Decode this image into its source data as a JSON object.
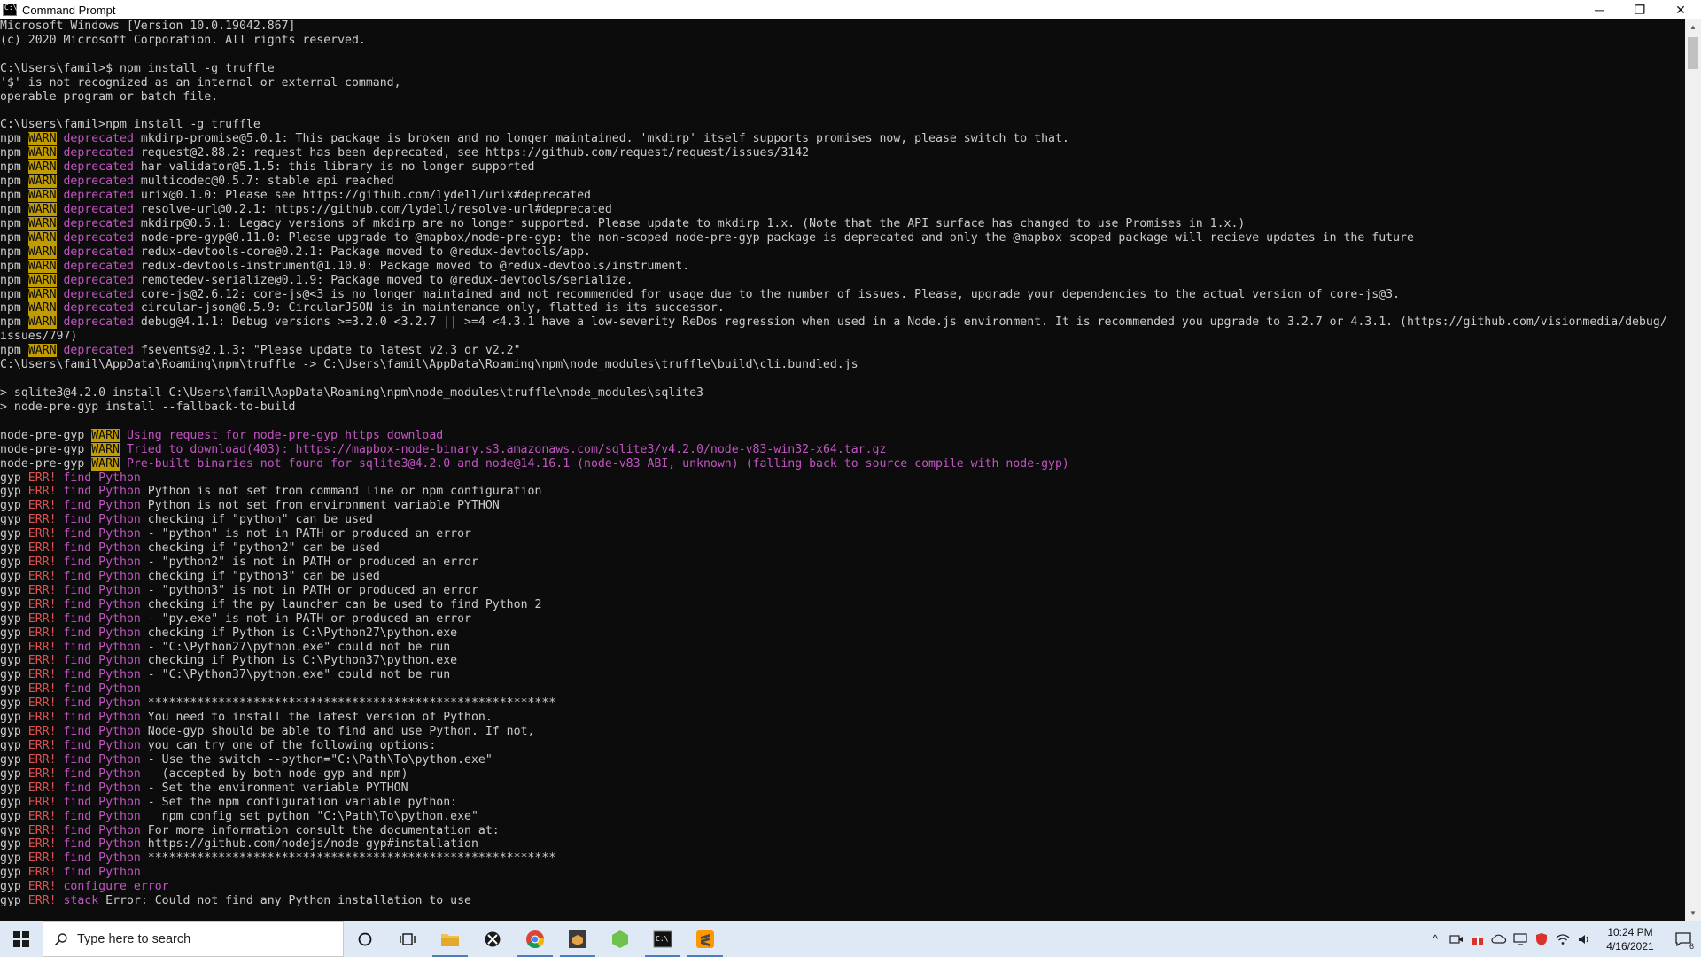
{
  "window": {
    "title": "Command Prompt",
    "controls": {
      "minimize": "─",
      "maximize": "❐",
      "close": "✕"
    }
  },
  "console": {
    "lines": [
      [
        {
          "t": "Microsoft Windows [Version 10.0.19042.867]"
        }
      ],
      [
        {
          "t": "(c) 2020 Microsoft Corporation. All rights reserved."
        }
      ],
      [
        {
          "t": ""
        }
      ],
      [
        {
          "t": "C:\\Users\\famil>$ npm install -g truffle"
        }
      ],
      [
        {
          "t": "'$' is not recognized as an internal or external command,"
        }
      ],
      [
        {
          "t": "operable program or batch file."
        }
      ],
      [
        {
          "t": ""
        }
      ],
      [
        {
          "t": "C:\\Users\\famil>npm install -g truffle"
        }
      ],
      [
        {
          "t": "npm "
        },
        {
          "t": "WARN",
          "s": "warn"
        },
        {
          "t": " "
        },
        {
          "t": "deprecated",
          "s": "mag"
        },
        {
          "t": " mkdirp-promise@5.0.1: This package is broken and no longer maintained. 'mkdirp' itself supports promises now, please switch to that."
        }
      ],
      [
        {
          "t": "npm "
        },
        {
          "t": "WARN",
          "s": "warn"
        },
        {
          "t": " "
        },
        {
          "t": "deprecated",
          "s": "mag"
        },
        {
          "t": " request@2.88.2: request has been deprecated, see https://github.com/request/request/issues/3142"
        }
      ],
      [
        {
          "t": "npm "
        },
        {
          "t": "WARN",
          "s": "warn"
        },
        {
          "t": " "
        },
        {
          "t": "deprecated",
          "s": "mag"
        },
        {
          "t": " har-validator@5.1.5: this library is no longer supported"
        }
      ],
      [
        {
          "t": "npm "
        },
        {
          "t": "WARN",
          "s": "warn"
        },
        {
          "t": " "
        },
        {
          "t": "deprecated",
          "s": "mag"
        },
        {
          "t": " multicodec@0.5.7: stable api reached"
        }
      ],
      [
        {
          "t": "npm "
        },
        {
          "t": "WARN",
          "s": "warn"
        },
        {
          "t": " "
        },
        {
          "t": "deprecated",
          "s": "mag"
        },
        {
          "t": " urix@0.1.0: Please see https://github.com/lydell/urix#deprecated"
        }
      ],
      [
        {
          "t": "npm "
        },
        {
          "t": "WARN",
          "s": "warn"
        },
        {
          "t": " "
        },
        {
          "t": "deprecated",
          "s": "mag"
        },
        {
          "t": " resolve-url@0.2.1: https://github.com/lydell/resolve-url#deprecated"
        }
      ],
      [
        {
          "t": "npm "
        },
        {
          "t": "WARN",
          "s": "warn"
        },
        {
          "t": " "
        },
        {
          "t": "deprecated",
          "s": "mag"
        },
        {
          "t": " mkdirp@0.5.1: Legacy versions of mkdirp are no longer supported. Please update to mkdirp 1.x. (Note that the API surface has changed to use Promises in 1.x.)"
        }
      ],
      [
        {
          "t": "npm "
        },
        {
          "t": "WARN",
          "s": "warn"
        },
        {
          "t": " "
        },
        {
          "t": "deprecated",
          "s": "mag"
        },
        {
          "t": " node-pre-gyp@0.11.0: Please upgrade to @mapbox/node-pre-gyp: the non-scoped node-pre-gyp package is deprecated and only the @mapbox scoped package will recieve updates in the future"
        }
      ],
      [
        {
          "t": "npm "
        },
        {
          "t": "WARN",
          "s": "warn"
        },
        {
          "t": " "
        },
        {
          "t": "deprecated",
          "s": "mag"
        },
        {
          "t": " redux-devtools-core@0.2.1: Package moved to @redux-devtools/app."
        }
      ],
      [
        {
          "t": "npm "
        },
        {
          "t": "WARN",
          "s": "warn"
        },
        {
          "t": " "
        },
        {
          "t": "deprecated",
          "s": "mag"
        },
        {
          "t": " redux-devtools-instrument@1.10.0: Package moved to @redux-devtools/instrument."
        }
      ],
      [
        {
          "t": "npm "
        },
        {
          "t": "WARN",
          "s": "warn"
        },
        {
          "t": " "
        },
        {
          "t": "deprecated",
          "s": "mag"
        },
        {
          "t": " remotedev-serialize@0.1.9: Package moved to @redux-devtools/serialize."
        }
      ],
      [
        {
          "t": "npm "
        },
        {
          "t": "WARN",
          "s": "warn"
        },
        {
          "t": " "
        },
        {
          "t": "deprecated",
          "s": "mag"
        },
        {
          "t": " core-js@2.6.12: core-js@<3 is no longer maintained and not recommended for usage due to the number of issues. Please, upgrade your dependencies to the actual version of core-js@3."
        }
      ],
      [
        {
          "t": "npm "
        },
        {
          "t": "WARN",
          "s": "warn"
        },
        {
          "t": " "
        },
        {
          "t": "deprecated",
          "s": "mag"
        },
        {
          "t": " circular-json@0.5.9: CircularJSON is in maintenance only, flatted is its successor."
        }
      ],
      [
        {
          "t": "npm "
        },
        {
          "t": "WARN",
          "s": "warn"
        },
        {
          "t": " "
        },
        {
          "t": "deprecated",
          "s": "mag"
        },
        {
          "t": " debug@4.1.1: Debug versions >=3.2.0 <3.2.7 || >=4 <4.3.1 have a low-severity ReDos regression when used in a Node.js environment. It is recommended you upgrade to 3.2.7 or 4.3.1. (https://github.com/visionmedia/debug/"
        }
      ],
      [
        {
          "t": "issues/797)"
        }
      ],
      [
        {
          "t": "npm "
        },
        {
          "t": "WARN",
          "s": "warn"
        },
        {
          "t": " "
        },
        {
          "t": "deprecated",
          "s": "mag"
        },
        {
          "t": " fsevents@2.1.3: \"Please update to latest v2.3 or v2.2\""
        }
      ],
      [
        {
          "t": "C:\\Users\\famil\\AppData\\Roaming\\npm\\truffle -> C:\\Users\\famil\\AppData\\Roaming\\npm\\node_modules\\truffle\\build\\cli.bundled.js"
        }
      ],
      [
        {
          "t": ""
        }
      ],
      [
        {
          "t": "> sqlite3@4.2.0 install C:\\Users\\famil\\AppData\\Roaming\\npm\\node_modules\\truffle\\node_modules\\sqlite3"
        }
      ],
      [
        {
          "t": "> node-pre-gyp install --fallback-to-build"
        }
      ],
      [
        {
          "t": ""
        }
      ],
      [
        {
          "t": "node-pre-gyp "
        },
        {
          "t": "WARN",
          "s": "warn"
        },
        {
          "t": " "
        },
        {
          "t": "Using request for node-pre-gyp https download",
          "s": "mag"
        }
      ],
      [
        {
          "t": "node-pre-gyp "
        },
        {
          "t": "WARN",
          "s": "warn"
        },
        {
          "t": " "
        },
        {
          "t": "Tried to download(403): https://mapbox-node-binary.s3.amazonaws.com/sqlite3/v4.2.0/node-v83-win32-x64.tar.gz",
          "s": "mag"
        }
      ],
      [
        {
          "t": "node-pre-gyp "
        },
        {
          "t": "WARN",
          "s": "warn"
        },
        {
          "t": " "
        },
        {
          "t": "Pre-built binaries not found for sqlite3@4.2.0 and node@14.16.1 (node-v83 ABI, unknown) (falling back to source compile with node-gyp)",
          "s": "mag"
        }
      ],
      [
        {
          "t": "gyp "
        },
        {
          "t": "ERR!",
          "s": "err"
        },
        {
          "t": " "
        },
        {
          "t": "find Python",
          "s": "findp"
        }
      ],
      [
        {
          "t": "gyp "
        },
        {
          "t": "ERR!",
          "s": "err"
        },
        {
          "t": " "
        },
        {
          "t": "find Python",
          "s": "findp"
        },
        {
          "t": " Python is not set from command line or npm configuration"
        }
      ],
      [
        {
          "t": "gyp "
        },
        {
          "t": "ERR!",
          "s": "err"
        },
        {
          "t": " "
        },
        {
          "t": "find Python",
          "s": "findp"
        },
        {
          "t": " Python is not set from environment variable PYTHON"
        }
      ],
      [
        {
          "t": "gyp "
        },
        {
          "t": "ERR!",
          "s": "err"
        },
        {
          "t": " "
        },
        {
          "t": "find Python",
          "s": "findp"
        },
        {
          "t": " checking if \"python\" can be used"
        }
      ],
      [
        {
          "t": "gyp "
        },
        {
          "t": "ERR!",
          "s": "err"
        },
        {
          "t": " "
        },
        {
          "t": "find Python",
          "s": "findp"
        },
        {
          "t": " - \"python\" is not in PATH or produced an error"
        }
      ],
      [
        {
          "t": "gyp "
        },
        {
          "t": "ERR!",
          "s": "err"
        },
        {
          "t": " "
        },
        {
          "t": "find Python",
          "s": "findp"
        },
        {
          "t": " checking if \"python2\" can be used"
        }
      ],
      [
        {
          "t": "gyp "
        },
        {
          "t": "ERR!",
          "s": "err"
        },
        {
          "t": " "
        },
        {
          "t": "find Python",
          "s": "findp"
        },
        {
          "t": " - \"python2\" is not in PATH or produced an error"
        }
      ],
      [
        {
          "t": "gyp "
        },
        {
          "t": "ERR!",
          "s": "err"
        },
        {
          "t": " "
        },
        {
          "t": "find Python",
          "s": "findp"
        },
        {
          "t": " checking if \"python3\" can be used"
        }
      ],
      [
        {
          "t": "gyp "
        },
        {
          "t": "ERR!",
          "s": "err"
        },
        {
          "t": " "
        },
        {
          "t": "find Python",
          "s": "findp"
        },
        {
          "t": " - \"python3\" is not in PATH or produced an error"
        }
      ],
      [
        {
          "t": "gyp "
        },
        {
          "t": "ERR!",
          "s": "err"
        },
        {
          "t": " "
        },
        {
          "t": "find Python",
          "s": "findp"
        },
        {
          "t": " checking if the py launcher can be used to find Python 2"
        }
      ],
      [
        {
          "t": "gyp "
        },
        {
          "t": "ERR!",
          "s": "err"
        },
        {
          "t": " "
        },
        {
          "t": "find Python",
          "s": "findp"
        },
        {
          "t": " - \"py.exe\" is not in PATH or produced an error"
        }
      ],
      [
        {
          "t": "gyp "
        },
        {
          "t": "ERR!",
          "s": "err"
        },
        {
          "t": " "
        },
        {
          "t": "find Python",
          "s": "findp"
        },
        {
          "t": " checking if Python is C:\\Python27\\python.exe"
        }
      ],
      [
        {
          "t": "gyp "
        },
        {
          "t": "ERR!",
          "s": "err"
        },
        {
          "t": " "
        },
        {
          "t": "find Python",
          "s": "findp"
        },
        {
          "t": " - \"C:\\Python27\\python.exe\" could not be run"
        }
      ],
      [
        {
          "t": "gyp "
        },
        {
          "t": "ERR!",
          "s": "err"
        },
        {
          "t": " "
        },
        {
          "t": "find Python",
          "s": "findp"
        },
        {
          "t": " checking if Python is C:\\Python37\\python.exe"
        }
      ],
      [
        {
          "t": "gyp "
        },
        {
          "t": "ERR!",
          "s": "err"
        },
        {
          "t": " "
        },
        {
          "t": "find Python",
          "s": "findp"
        },
        {
          "t": " - \"C:\\Python37\\python.exe\" could not be run"
        }
      ],
      [
        {
          "t": "gyp "
        },
        {
          "t": "ERR!",
          "s": "err"
        },
        {
          "t": " "
        },
        {
          "t": "find Python",
          "s": "findp"
        }
      ],
      [
        {
          "t": "gyp "
        },
        {
          "t": "ERR!",
          "s": "err"
        },
        {
          "t": " "
        },
        {
          "t": "find Python",
          "s": "findp"
        },
        {
          "t": " **********************************************************"
        }
      ],
      [
        {
          "t": "gyp "
        },
        {
          "t": "ERR!",
          "s": "err"
        },
        {
          "t": " "
        },
        {
          "t": "find Python",
          "s": "findp"
        },
        {
          "t": " You need to install the latest version of Python."
        }
      ],
      [
        {
          "t": "gyp "
        },
        {
          "t": "ERR!",
          "s": "err"
        },
        {
          "t": " "
        },
        {
          "t": "find Python",
          "s": "findp"
        },
        {
          "t": " Node-gyp should be able to find and use Python. If not,"
        }
      ],
      [
        {
          "t": "gyp "
        },
        {
          "t": "ERR!",
          "s": "err"
        },
        {
          "t": " "
        },
        {
          "t": "find Python",
          "s": "findp"
        },
        {
          "t": " you can try one of the following options:"
        }
      ],
      [
        {
          "t": "gyp "
        },
        {
          "t": "ERR!",
          "s": "err"
        },
        {
          "t": " "
        },
        {
          "t": "find Python",
          "s": "findp"
        },
        {
          "t": " - Use the switch --python=\"C:\\Path\\To\\python.exe\""
        }
      ],
      [
        {
          "t": "gyp "
        },
        {
          "t": "ERR!",
          "s": "err"
        },
        {
          "t": " "
        },
        {
          "t": "find Python",
          "s": "findp"
        },
        {
          "t": "   (accepted by both node-gyp and npm)"
        }
      ],
      [
        {
          "t": "gyp "
        },
        {
          "t": "ERR!",
          "s": "err"
        },
        {
          "t": " "
        },
        {
          "t": "find Python",
          "s": "findp"
        },
        {
          "t": " - Set the environment variable PYTHON"
        }
      ],
      [
        {
          "t": "gyp "
        },
        {
          "t": "ERR!",
          "s": "err"
        },
        {
          "t": " "
        },
        {
          "t": "find Python",
          "s": "findp"
        },
        {
          "t": " - Set the npm configuration variable python:"
        }
      ],
      [
        {
          "t": "gyp "
        },
        {
          "t": "ERR!",
          "s": "err"
        },
        {
          "t": " "
        },
        {
          "t": "find Python",
          "s": "findp"
        },
        {
          "t": "   npm config set python \"C:\\Path\\To\\python.exe\""
        }
      ],
      [
        {
          "t": "gyp "
        },
        {
          "t": "ERR!",
          "s": "err"
        },
        {
          "t": " "
        },
        {
          "t": "find Python",
          "s": "findp"
        },
        {
          "t": " For more information consult the documentation at:"
        }
      ],
      [
        {
          "t": "gyp "
        },
        {
          "t": "ERR!",
          "s": "err"
        },
        {
          "t": " "
        },
        {
          "t": "find Python",
          "s": "findp"
        },
        {
          "t": " https://github.com/nodejs/node-gyp#installation"
        }
      ],
      [
        {
          "t": "gyp "
        },
        {
          "t": "ERR!",
          "s": "err"
        },
        {
          "t": " "
        },
        {
          "t": "find Python",
          "s": "findp"
        },
        {
          "t": " **********************************************************"
        }
      ],
      [
        {
          "t": "gyp "
        },
        {
          "t": "ERR!",
          "s": "err"
        },
        {
          "t": " "
        },
        {
          "t": "find Python",
          "s": "findp"
        }
      ],
      [
        {
          "t": "gyp "
        },
        {
          "t": "ERR!",
          "s": "err"
        },
        {
          "t": " "
        },
        {
          "t": "configure error",
          "s": "findp"
        }
      ],
      [
        {
          "t": "gyp "
        },
        {
          "t": "ERR!",
          "s": "err"
        },
        {
          "t": " "
        },
        {
          "t": "stack",
          "s": "findp"
        },
        {
          "t": " Error: Could not find any Python installation to use"
        }
      ]
    ]
  },
  "colors": {
    "console_bg": "#0c0c0c",
    "console_fg": "#cccccc",
    "warn_bg": "#c19c00",
    "magenta": "#c255c2",
    "err_red": "#e05252",
    "taskbar_bg": "#dfe8f5"
  },
  "taskbar": {
    "search_placeholder": "Type here to search",
    "pinned": [
      {
        "name": "cortana-icon"
      },
      {
        "name": "task-view-icon"
      },
      {
        "name": "file-explorer-icon"
      },
      {
        "name": "xbox-icon"
      },
      {
        "name": "chrome-icon"
      },
      {
        "name": "app-box-icon"
      },
      {
        "name": "nodejs-icon"
      },
      {
        "name": "command-prompt-icon"
      },
      {
        "name": "sublime-text-icon"
      }
    ],
    "clock": {
      "time": "10:24 PM",
      "date": "4/16/2021"
    },
    "notification_count": "6"
  }
}
